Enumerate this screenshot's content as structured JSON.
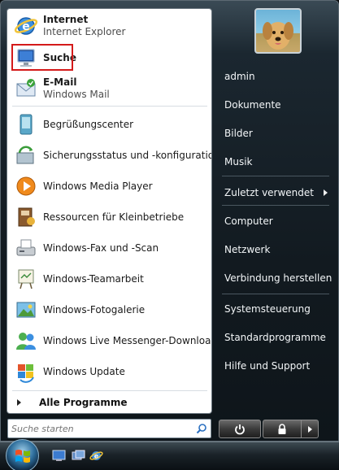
{
  "left_items": [
    {
      "key": "internet",
      "title": "Internet",
      "subtitle": "Internet Explorer",
      "icon": "internet-explorer-icon"
    },
    {
      "key": "suche",
      "title": "Suche",
      "subtitle": "",
      "icon": "search-monitor-icon"
    },
    {
      "key": "email",
      "title": "E-Mail",
      "subtitle": "Windows Mail",
      "icon": "windows-mail-icon"
    },
    {
      "key": "begruessung",
      "title": "Begrüßungscenter",
      "icon": "welcome-center-icon"
    },
    {
      "key": "sicherung",
      "title": "Sicherungsstatus und -konfiguration",
      "icon": "backup-icon"
    },
    {
      "key": "mediaplayer",
      "title": "Windows Media Player",
      "icon": "media-player-icon"
    },
    {
      "key": "ressourcen",
      "title": "Ressourcen für Kleinbetriebe",
      "icon": "small-business-icon"
    },
    {
      "key": "fax",
      "title": "Windows-Fax und -Scan",
      "icon": "fax-scan-icon"
    },
    {
      "key": "teamarbeit",
      "title": "Windows-Teamarbeit",
      "icon": "meeting-space-icon"
    },
    {
      "key": "fotogalerie",
      "title": "Windows-Fotogalerie",
      "icon": "photo-gallery-icon"
    },
    {
      "key": "messenger",
      "title": "Windows Live Messenger-Download",
      "icon": "messenger-icon"
    },
    {
      "key": "update",
      "title": "Windows Update",
      "icon": "windows-update-icon"
    }
  ],
  "all_programs": "Alle Programme",
  "search": {
    "placeholder": "Suche starten"
  },
  "right_items": [
    {
      "label": "admin"
    },
    {
      "label": "Dokumente"
    },
    {
      "label": "Bilder"
    },
    {
      "label": "Musik"
    },
    {
      "label": "Zuletzt verwendet"
    },
    {
      "label": "Computer"
    },
    {
      "label": "Netzwerk"
    },
    {
      "label": "Verbindung herstellen"
    },
    {
      "label": "Systemsteuerung"
    },
    {
      "label": "Standardprogramme"
    },
    {
      "label": "Hilfe und Support"
    }
  ],
  "colors": {
    "highlight": "#d41a1a",
    "accent": "#1e6fb8"
  }
}
